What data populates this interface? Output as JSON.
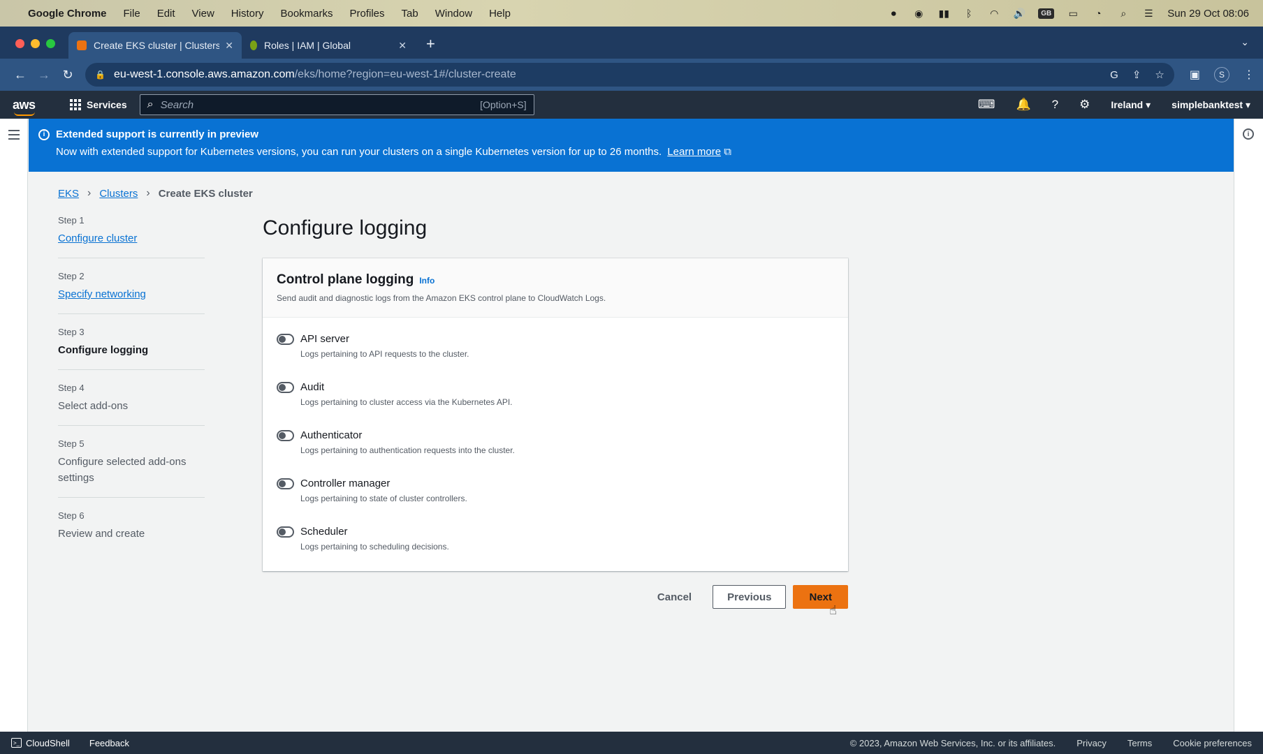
{
  "macos": {
    "app_name": "Google Chrome",
    "menu": [
      "File",
      "Edit",
      "View",
      "History",
      "Bookmarks",
      "Profiles",
      "Tab",
      "Window",
      "Help"
    ],
    "datetime": "Sun 29 Oct  08:06",
    "keyboard_badge": "GB"
  },
  "browser": {
    "tabs": [
      {
        "title": "Create EKS cluster | Clusters |",
        "favicon_color": "#ec7211",
        "active": true
      },
      {
        "title": "Roles | IAM | Global",
        "favicon_color": "#7aa116",
        "active": false
      }
    ],
    "url_host": "eu-west-1.console.aws.amazon.com",
    "url_path": "/eks/home?region=eu-west-1#/cluster-create",
    "profile_initial": "S"
  },
  "aws_header": {
    "logo": "aws",
    "services_label": "Services",
    "search_placeholder": "Search",
    "search_shortcut": "[Option+S]",
    "region": "Ireland ▾",
    "account": "simplebanktest ▾"
  },
  "banner": {
    "title": "Extended support is currently in preview",
    "text": "Now with extended support for Kubernetes versions, you can run your clusters on a single Kubernetes version for up to 26 months.",
    "link": "Learn more"
  },
  "breadcrumb": {
    "items": [
      "EKS",
      "Clusters"
    ],
    "current": "Create EKS cluster"
  },
  "steps": [
    {
      "num": "Step 1",
      "label": "Configure cluster"
    },
    {
      "num": "Step 2",
      "label": "Specify networking"
    },
    {
      "num": "Step 3",
      "label": "Configure logging"
    },
    {
      "num": "Step 4",
      "label": "Select add-ons"
    },
    {
      "num": "Step 5",
      "label": "Configure selected add-ons settings"
    },
    {
      "num": "Step 6",
      "label": "Review and create"
    }
  ],
  "page_title": "Configure logging",
  "panel": {
    "title": "Control plane logging",
    "info": "Info",
    "description": "Send audit and diagnostic logs from the Amazon EKS control plane to CloudWatch Logs.",
    "toggles": [
      {
        "label": "API server",
        "desc": "Logs pertaining to API requests to the cluster."
      },
      {
        "label": "Audit",
        "desc": "Logs pertaining to cluster access via the Kubernetes API."
      },
      {
        "label": "Authenticator",
        "desc": "Logs pertaining to authentication requests into the cluster."
      },
      {
        "label": "Controller manager",
        "desc": "Logs pertaining to state of cluster controllers."
      },
      {
        "label": "Scheduler",
        "desc": "Logs pertaining to scheduling decisions."
      }
    ]
  },
  "actions": {
    "cancel": "Cancel",
    "previous": "Previous",
    "next": "Next"
  },
  "footer": {
    "cloudshell": "CloudShell",
    "feedback": "Feedback",
    "copyright": "© 2023, Amazon Web Services, Inc. or its affiliates.",
    "privacy": "Privacy",
    "terms": "Terms",
    "cookies": "Cookie preferences"
  },
  "colors": {
    "aws_navy": "#232f3e",
    "banner_blue": "#0972d3",
    "primary_orange": "#ec7211",
    "link_blue": "#0972d3"
  }
}
